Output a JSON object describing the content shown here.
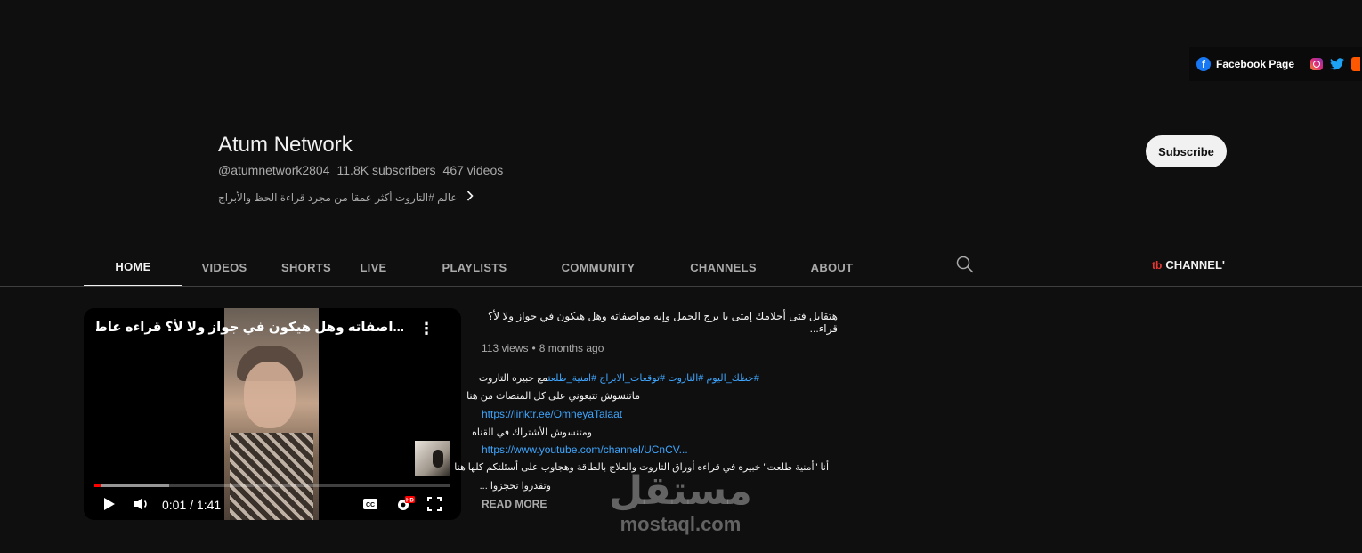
{
  "links_bar": {
    "facebook_label": "Facebook Page",
    "icons": [
      "facebook-icon",
      "instagram-icon",
      "twitter-icon",
      "reddit-icon"
    ]
  },
  "channel": {
    "name": "Atum Network",
    "handle": "@atumnetwork2804",
    "subscribers": "11.8K subscribers",
    "videos": "467 videos",
    "description": "عالم #التاروت أكثر عمقا من مجرد قراءة الحظ والأبراج",
    "subscribe_label": "Subscribe"
  },
  "tabs": [
    {
      "label": "HOME",
      "active": true
    },
    {
      "label": "VIDEOS"
    },
    {
      "label": "SHORTS"
    },
    {
      "label": "LIVE"
    },
    {
      "label": "PLAYLISTS"
    },
    {
      "label": "COMMUNITY"
    },
    {
      "label": "CHANNELS"
    },
    {
      "label": "ABOUT"
    }
  ],
  "channel_tab": "CHANNEL'",
  "player": {
    "title": "...اصفاته وهل هيكون في جواز ولا لأ؟ قراءه عاطفية للعزاب",
    "time": "0:01 / 1:41",
    "progress_fraction": 0.02,
    "buffered_fraction": 0.21,
    "hd_badge": "HD"
  },
  "video": {
    "title": "هتقابل فتى أحلامك إمتى يا برج الحمل وإيه مواصفاته وهل هيكون في جواز ولا لأ؟ قراء...",
    "views": "113 views",
    "age": "8 months ago",
    "desc": {
      "line1_tags": "#حظك_اليوم #التاروت #توقعات_الابراج #امنية_طلعت",
      "line1_text": "مع خبيره التاروت",
      "line2": "ماتنسوش تتبعوني على كل المنصات من هنا",
      "link1": "https://linktr.ee/OmneyaTalaat",
      "line3": "ومتنسوش الأشتراك في القناه",
      "link2": "https://www.youtube.com/channel/UCnCV...",
      "line4": "أنا \"أمنية طلعت\" خبيره في قراءه أوراق التاروت والعلاج بالطاقة وهجاوب على أسئلتكم كلها هنا",
      "line5": "وتقدروا تحجزوا ...",
      "read_more": "READ MORE"
    }
  },
  "watermark": {
    "arabic": "مستقل",
    "latin": "mostaql.com"
  }
}
